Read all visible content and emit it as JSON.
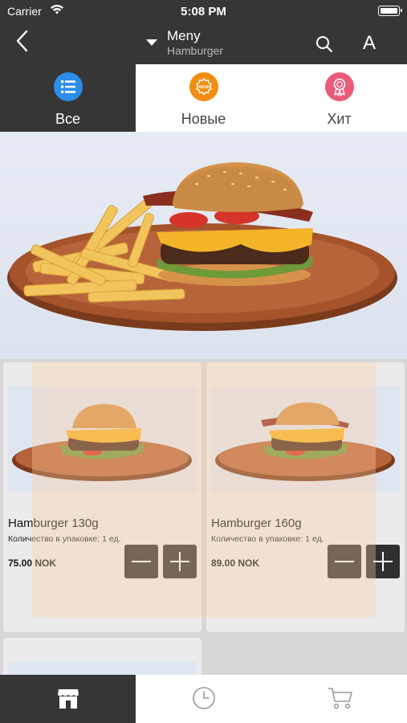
{
  "status": {
    "carrier": "Carrier",
    "time": "5:08 PM",
    "battery_level": 1.0
  },
  "nav": {
    "title": "Meny",
    "subtitle": "Hamburger",
    "font_button": "A"
  },
  "tabs": [
    {
      "label": "Все",
      "icon": "list-icon",
      "color": "#2b8ee9"
    },
    {
      "label": "Новые",
      "icon": "new-badge-icon",
      "color": "#f08d12"
    },
    {
      "label": "Хит",
      "icon": "award-ribbon-icon",
      "color": "#ea5b78"
    }
  ],
  "products": [
    {
      "name": "Hamburger 130g",
      "qty": "Количество в упаковке: 1 ед.",
      "price": "75.00 NOK"
    },
    {
      "name": "Hamburger 160g",
      "qty": "Количество в упаковке: 1 ед.",
      "price": "89.00 NOK"
    }
  ],
  "bottom_nav": [
    {
      "icon": "store-icon"
    },
    {
      "icon": "clock-icon"
    },
    {
      "icon": "cart-icon"
    }
  ],
  "colors": {
    "bar": "#363636",
    "accent_plate": "#a5532a",
    "bun": "#d7924a"
  }
}
